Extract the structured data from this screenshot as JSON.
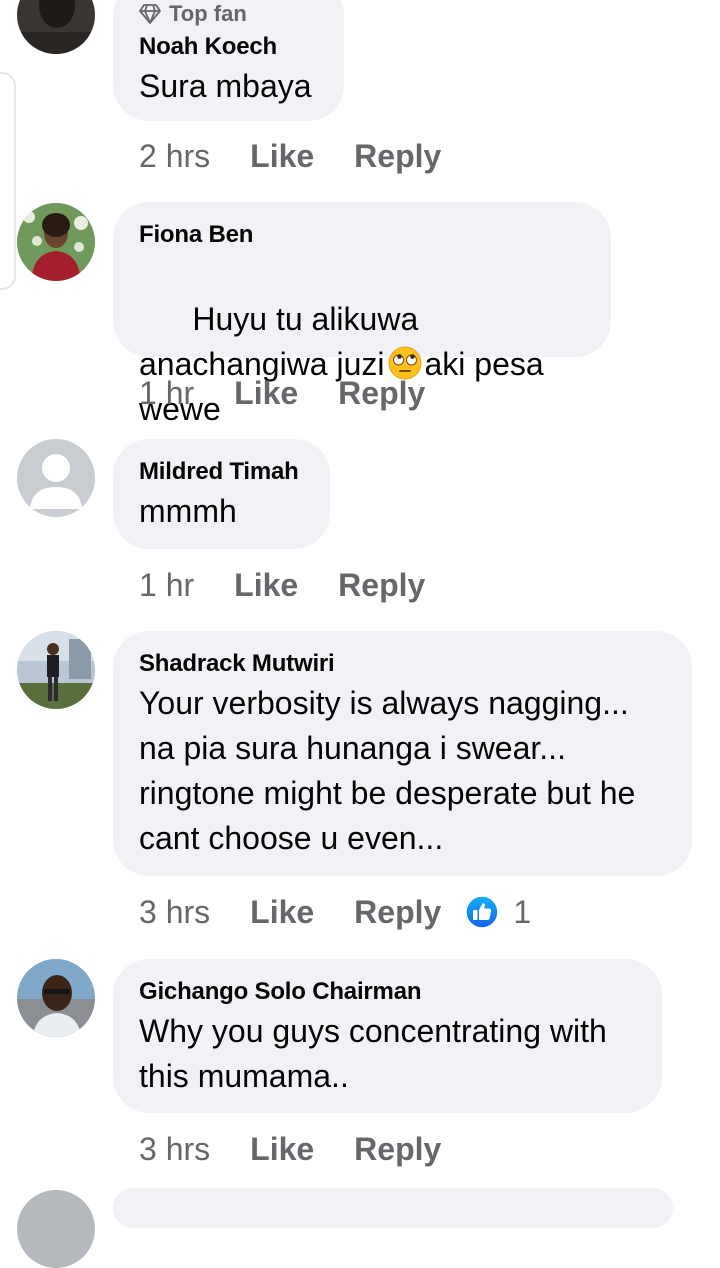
{
  "colors": {
    "bubble": "#f0f2f5",
    "meta": "#65676b",
    "like_blue": "#1877f2",
    "text": "#050505"
  },
  "comments": [
    {
      "badge_icon": "diamond-icon",
      "badge": "Top fan",
      "author": "Noah Koech",
      "text": "Sura mbaya",
      "time": "2 hrs",
      "like": "Like",
      "reply": "Reply"
    },
    {
      "author": "Fiona Ben",
      "text_before_emoji": "Huyu tu alikuwa anachangiwa juzi",
      "emoji": "eye-roll-emoji",
      "text_after_emoji": "aki pesa wewe",
      "time": "1 hr",
      "like": "Like",
      "reply": "Reply"
    },
    {
      "author": "Mildred Timah",
      "text": "mmmh",
      "time": "1 hr",
      "like": "Like",
      "reply": "Reply"
    },
    {
      "author": "Shadrack Mutwiri",
      "text": "Your verbosity is always nagging...\nna pia sura hunanga i swear...\nringtone might be desperate but he\ncant choose u even...",
      "time": "3 hrs",
      "like": "Like",
      "reply": "Reply",
      "reaction_icon": "thumbs-up-reaction-icon",
      "reaction_count": "1"
    },
    {
      "author": "Gichango Solo Chairman",
      "text": "Why you guys concentrating with\nthis mumama..",
      "time": "3 hrs",
      "like": "Like",
      "reply": "Reply"
    }
  ]
}
